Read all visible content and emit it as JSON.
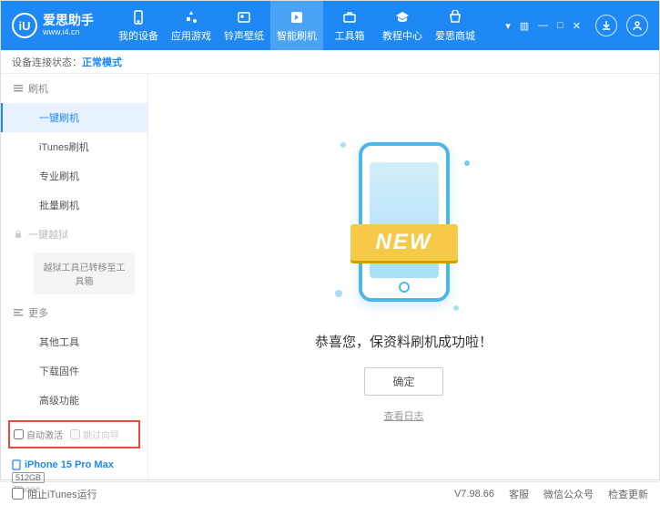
{
  "header": {
    "logo_text": "爱思助手",
    "logo_url": "www.i4.cn",
    "logo_mark": "iU",
    "nav": [
      {
        "label": "我的设备"
      },
      {
        "label": "应用游戏"
      },
      {
        "label": "铃声壁纸"
      },
      {
        "label": "智能刷机"
      },
      {
        "label": "工具箱"
      },
      {
        "label": "教程中心"
      },
      {
        "label": "爱思商城"
      }
    ]
  },
  "status": {
    "label": "设备连接状态：",
    "mode": "正常模式"
  },
  "sidebar": {
    "section_flash": "刷机",
    "items_flash": [
      "一键刷机",
      "iTunes刷机",
      "专业刷机",
      "批量刷机"
    ],
    "section_jailbreak": "一键越狱",
    "jailbreak_note": "越狱工具已转移至工具箱",
    "section_more": "更多",
    "items_more": [
      "其他工具",
      "下载固件",
      "高级功能"
    ],
    "checkbox1": "自动激活",
    "checkbox2": "跳过向导"
  },
  "device": {
    "name": "iPhone 15 Pro Max",
    "storage": "512GB",
    "type": "iPhone"
  },
  "main": {
    "ribbon": "NEW",
    "success": "恭喜您，保资料刷机成功啦！",
    "ok": "确定",
    "view_log": "查看日志"
  },
  "footer": {
    "block_itunes": "阻止iTunes运行",
    "version": "V7.98.66",
    "links": [
      "客服",
      "微信公众号",
      "检查更新"
    ]
  }
}
